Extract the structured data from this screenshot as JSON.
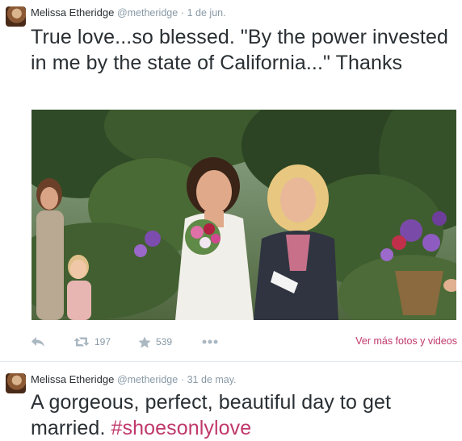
{
  "tweets": [
    {
      "fullname": "Melissa Etheridge",
      "username": "@metheridge",
      "separator": "·",
      "time": "1 de jun.",
      "text": "True love...so blessed. \"By the power invested in me by the state of California...\" Thanks",
      "actions": {
        "retweets": "197",
        "favorites": "539",
        "more_link": "Ver más fotos y videos"
      }
    },
    {
      "fullname": "Melissa Etheridge",
      "username": "@metheridge",
      "separator": "·",
      "time": "31 de may.",
      "text": "A gorgeous, perfect, beautiful day to get married.",
      "hashtag": "#shoesonlylove"
    }
  ],
  "icons": {
    "reply": "reply-icon",
    "retweet": "retweet-icon",
    "favorite": "star-icon",
    "more": "more-dots-icon"
  },
  "colors": {
    "link": "#c0396b",
    "meta": "#8899a6",
    "text": "#292f33"
  }
}
